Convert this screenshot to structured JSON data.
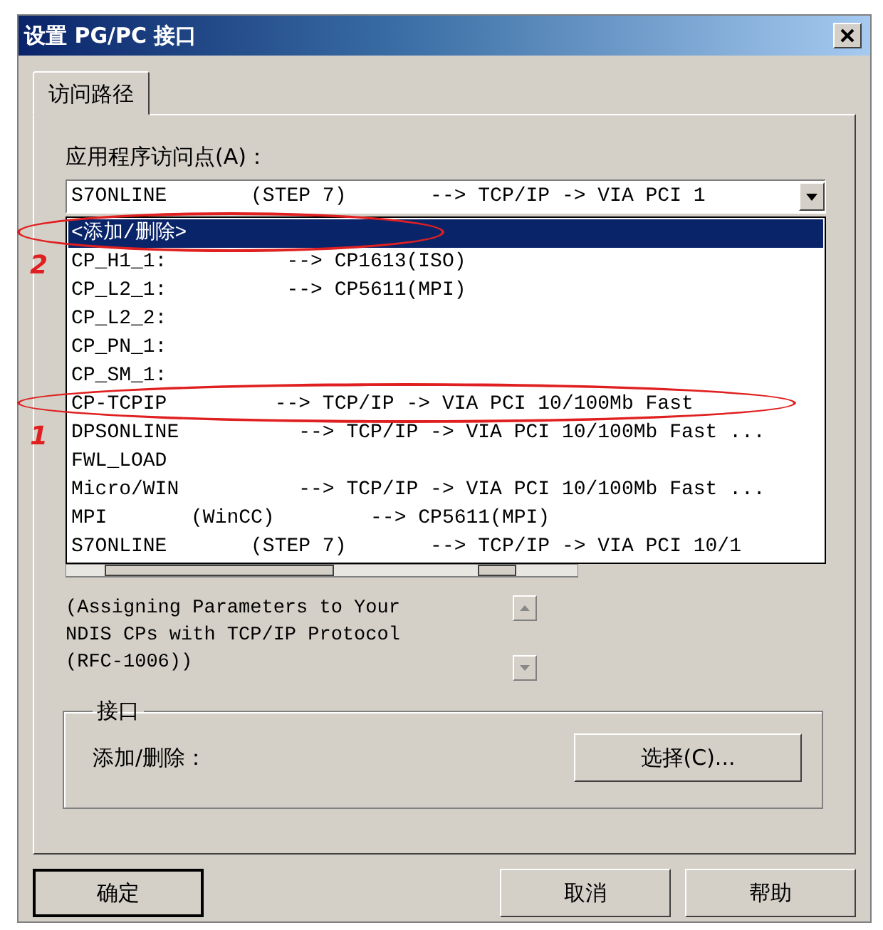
{
  "window": {
    "title": "设置 PG/PC 接口"
  },
  "tabs": [
    {
      "label": "访问路径",
      "selected": true
    }
  ],
  "access_point": {
    "label": "应用程序访问点(A)：",
    "value": "S7ONLINE       (STEP 7)       --> TCP/IP -> VIA PCI 1"
  },
  "dropdown_items": [
    {
      "text": "<添加/删除>",
      "selected": true,
      "annotation": "2"
    },
    {
      "text": "CP_H1_1:          --> CP1613(ISO)",
      "selected": false
    },
    {
      "text": "CP_L2_1:          --> CP5611(MPI)",
      "selected": false
    },
    {
      "text": "CP_L2_2:",
      "selected": false
    },
    {
      "text": "CP_PN_1:",
      "selected": false
    },
    {
      "text": "CP_SM_1:",
      "selected": false
    },
    {
      "text": "CP-TCPIP         --> TCP/IP -> VIA PCI 10/100Mb Fast",
      "selected": false,
      "annotation": "1"
    },
    {
      "text": "DPSONLINE          --> TCP/IP -> VIA PCI 10/100Mb Fast ...",
      "selected": false
    },
    {
      "text": "FWL_LOAD",
      "selected": false
    },
    {
      "text": "Micro/WIN          --> TCP/IP -> VIA PCI 10/100Mb Fast ...",
      "selected": false
    },
    {
      "text": "MPI       (WinCC)        --> CP5611(MPI)",
      "selected": false
    },
    {
      "text": "S7ONLINE       (STEP 7)       --> TCP/IP -> VIA PCI 10/1",
      "selected": false
    }
  ],
  "description": "(Assigning Parameters to Your NDIS CPs with TCP/IP Protocol (RFC-1006))",
  "interface_group": {
    "title": "接口",
    "label": "添加/删除：",
    "button": "选择(C)..."
  },
  "buttons": [
    {
      "label": "确定",
      "default": true
    },
    {
      "label": "取消",
      "default": false
    },
    {
      "label": "帮助",
      "default": false
    }
  ]
}
